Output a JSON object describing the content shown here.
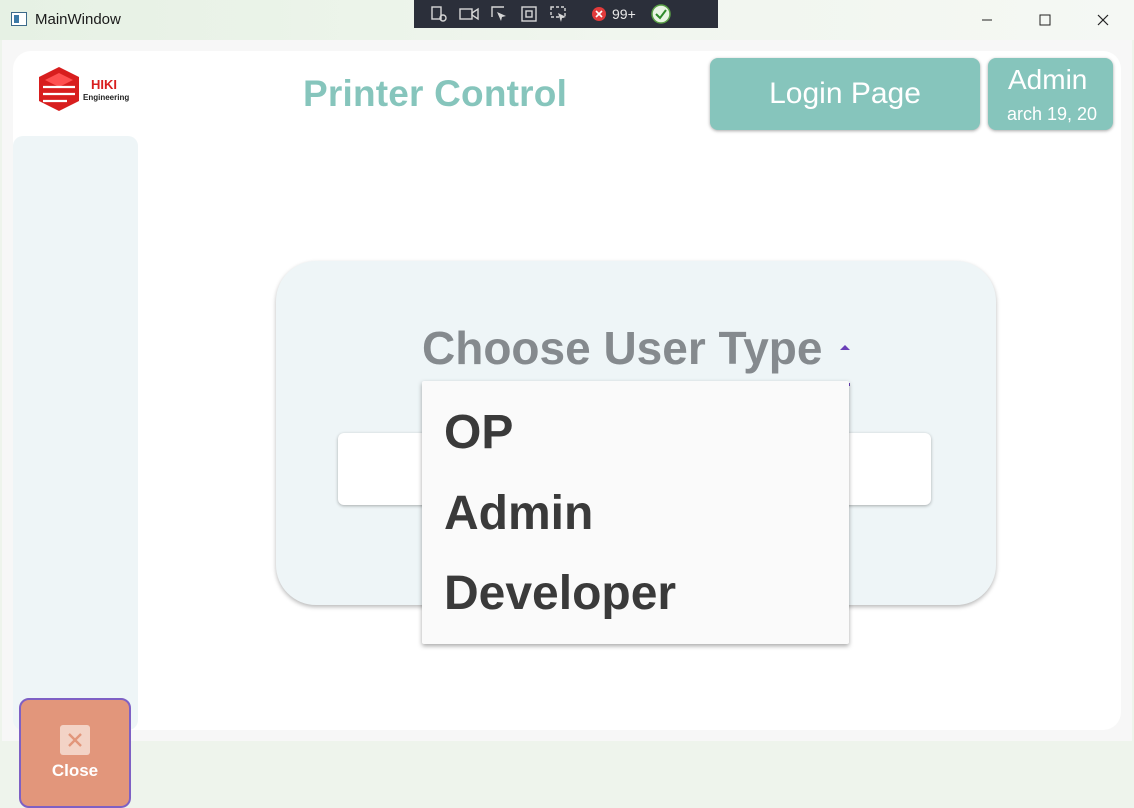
{
  "window": {
    "title": "MainWindow",
    "debug_counter": "99+"
  },
  "header": {
    "logo_text": "HIKI",
    "logo_subtext": "Engineering",
    "page_title": "Printer Control",
    "login_button": "Login Page",
    "user_name": "Admin",
    "date_text": "arch 19, 20"
  },
  "sidebar": {
    "close_label": "Close"
  },
  "login": {
    "user_type_label": "Choose User Type",
    "options": [
      "OP",
      "Admin",
      "Developer"
    ]
  },
  "colors": {
    "accent": "#86c5bc",
    "close": "#e2967b",
    "focus": "#6a3fb8"
  }
}
